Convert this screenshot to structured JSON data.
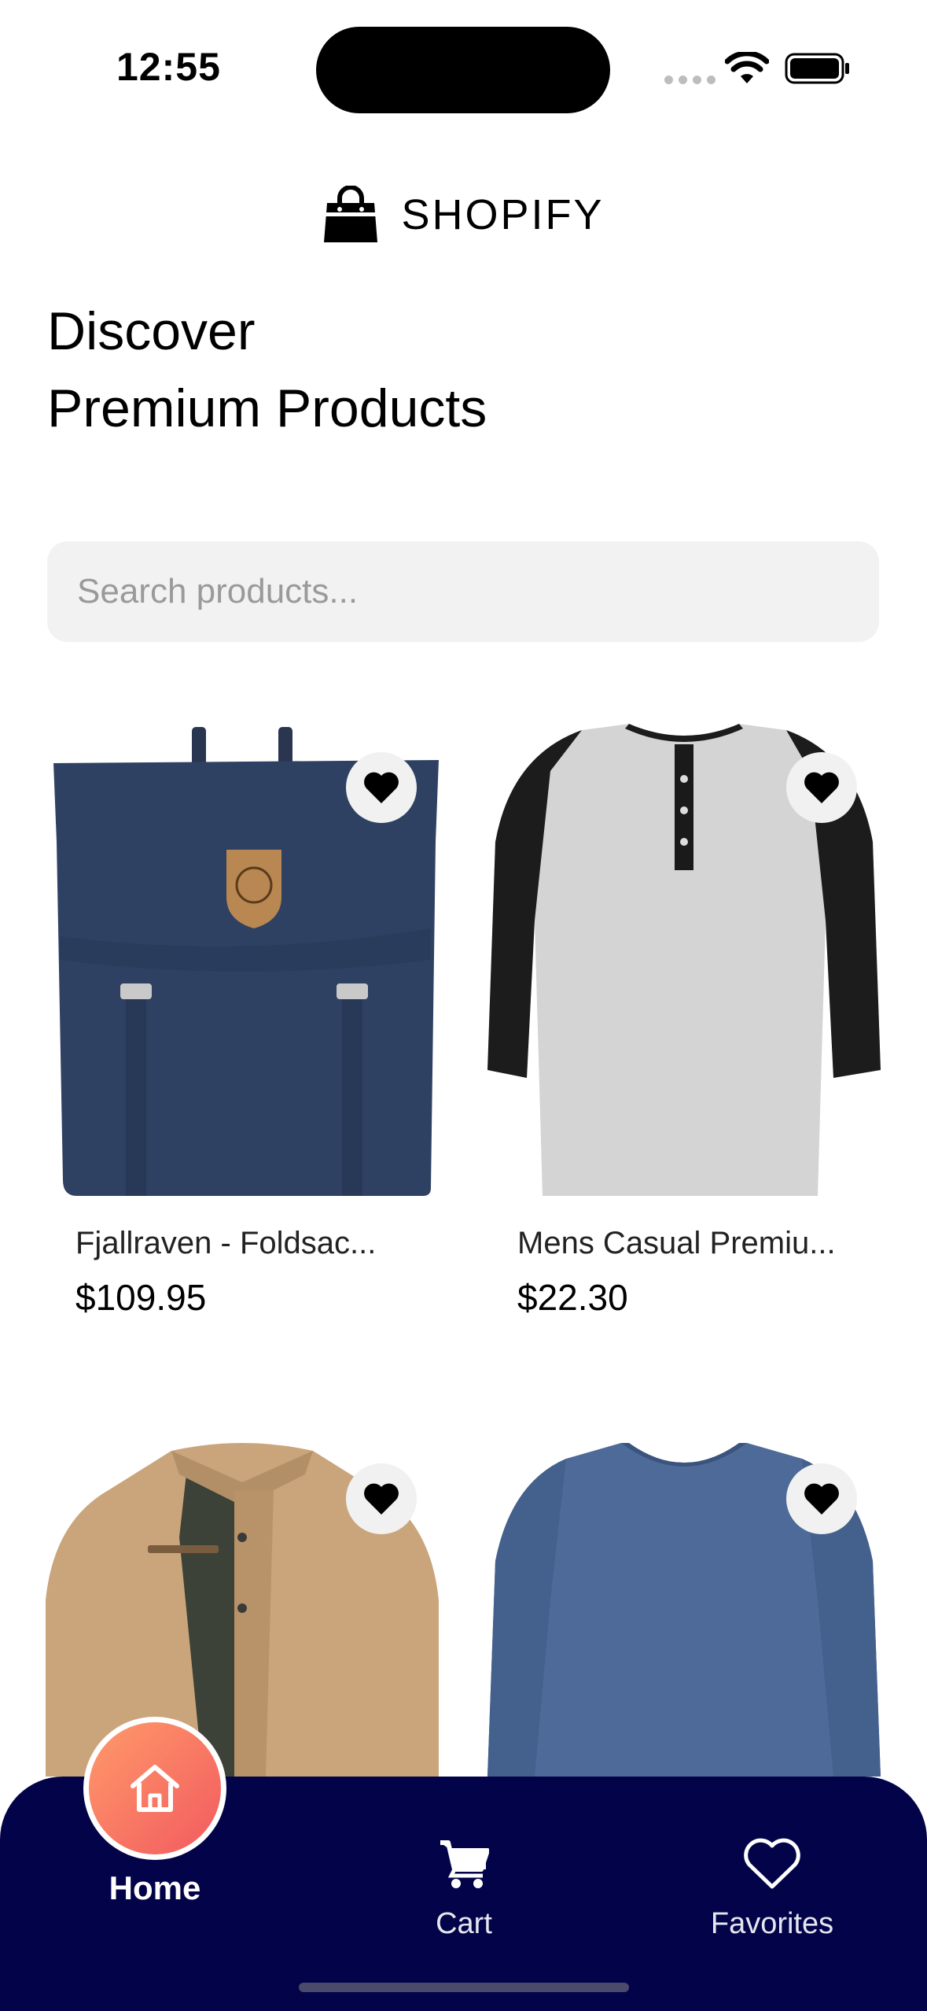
{
  "status_bar": {
    "time": "12:55"
  },
  "brand": {
    "name": "SHOPIFY",
    "icon": "shopping-bag-icon"
  },
  "headline": {
    "line1": "Discover",
    "line2": "Premium Products"
  },
  "search": {
    "placeholder": "Search products...",
    "value": ""
  },
  "products": [
    {
      "name": "Fjallraven - Foldsac...",
      "price": "$109.95",
      "image": "navy-backpack",
      "favorite_icon": "heart-icon"
    },
    {
      "name": "Mens Casual Premiu...",
      "price": "$22.30",
      "image": "raglan-henley-shirt",
      "favorite_icon": "heart-icon"
    },
    {
      "name": "",
      "price": "",
      "image": "khaki-cotton-jacket",
      "favorite_icon": "heart-icon"
    },
    {
      "name": "",
      "price": "",
      "image": "blue-long-sleeve-tee",
      "favorite_icon": "heart-icon"
    }
  ],
  "bottom_nav": {
    "items": [
      {
        "label": "Home",
        "icon": "home-icon",
        "active": true
      },
      {
        "label": "Cart",
        "icon": "cart-icon",
        "active": false
      },
      {
        "label": "Favorites",
        "icon": "heart-outline-icon",
        "active": false
      }
    ]
  },
  "colors": {
    "nav_background": "#03034a",
    "home_gradient_start": "#ff9a6a",
    "home_gradient_end": "#f25a5f",
    "search_background": "#f2f2f2"
  }
}
